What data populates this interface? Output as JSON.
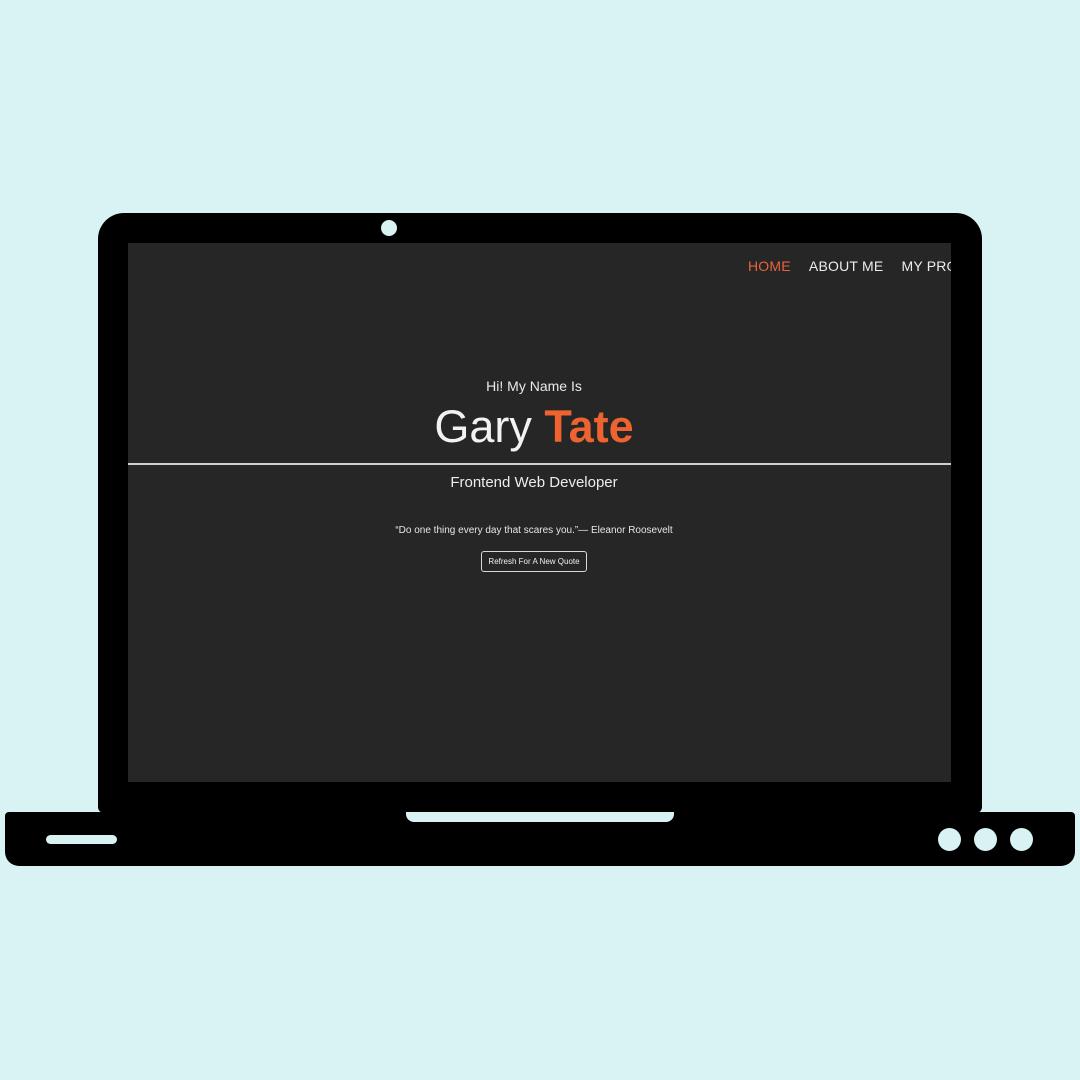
{
  "nav": {
    "items": [
      {
        "label": "HOME",
        "active": true
      },
      {
        "label": "ABOUT ME",
        "active": false
      },
      {
        "label": "MY PROJECTS",
        "active": false
      }
    ]
  },
  "hero": {
    "greeting": "Hi! My Name Is",
    "first_name": "Gary",
    "last_name": "Tate",
    "role": "Frontend Web Developer"
  },
  "quote": {
    "text": "“Do one thing every day that scares you.”— Eleanor Roosevelt",
    "button_label": "Refresh For A New Quote"
  },
  "colors": {
    "background": "#d9f3f5",
    "screen": "#262626",
    "accent": "#ee6330"
  }
}
